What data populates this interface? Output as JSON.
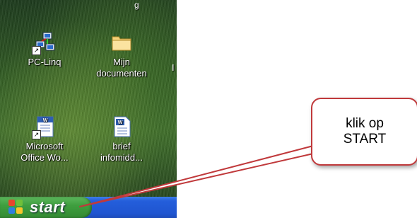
{
  "desktop": {
    "clipped_top_text": "g",
    "clipped_edge_text": "I",
    "icons": [
      {
        "label": "PC-Linq",
        "icon": "network-computers-icon"
      },
      {
        "label": "Mijn\ndocumenten",
        "icon": "folder-icon"
      },
      {
        "label": "Microsoft\nOffice Wo...",
        "icon": "word-document-icon"
      },
      {
        "label": "brief\ninfomidd...",
        "icon": "word-document-icon"
      }
    ]
  },
  "taskbar": {
    "start_label": "start",
    "start_icon": "windows-logo-icon",
    "color": "#245edb",
    "start_color": "#3f9f3f"
  },
  "callout": {
    "text": "klik op\nSTART",
    "border_color": "#c0393b"
  }
}
